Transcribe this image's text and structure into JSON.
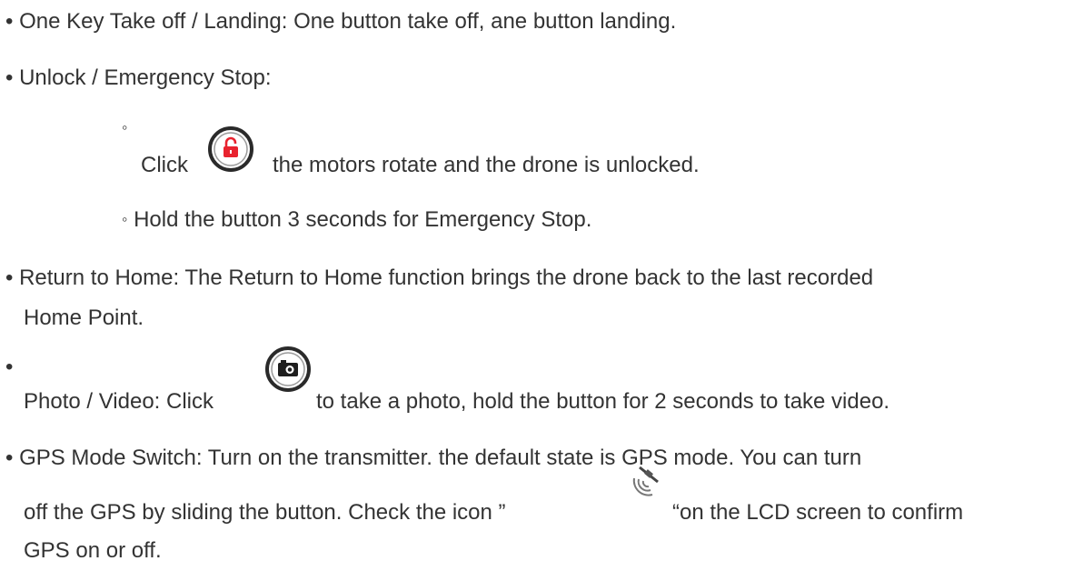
{
  "bullets": {
    "main": "•",
    "sub": "◦"
  },
  "items": [
    {
      "text": "One Key Take off / Landing: One button take off, ane button landing."
    },
    {
      "text": "Unlock / Emergency Stop:",
      "subitems": [
        {
          "before_icon": "Click",
          "icon": "unlock-button-icon",
          "after_icon": "the motors rotate and the drone is unlocked."
        },
        {
          "text": "Hold the button 3 seconds for Emergency Stop."
        }
      ]
    },
    {
      "line1": "Return to Home: The Return to Home function brings the drone back to the last recorded",
      "line2": "Home Point."
    },
    {
      "before_icon": "Photo / Video: Click",
      "icon": "camera-button-icon",
      "after_icon": "to take a photo, hold the button for 2 seconds to take video."
    },
    {
      "line1": "GPS Mode Switch: Turn on the transmitter. the default state is GPS mode. You can turn",
      "line2_before_icon": "off the GPS by sliding the button. Check the icon ”",
      "icon": "gps-satellite-icon",
      "line2_after_icon": "“on the LCD screen to confirm",
      "line3": "GPS on or off."
    }
  ],
  "colors": {
    "text": "#333333",
    "lock_red": "#e8232f",
    "ring_dark": "#2a2a2a"
  }
}
